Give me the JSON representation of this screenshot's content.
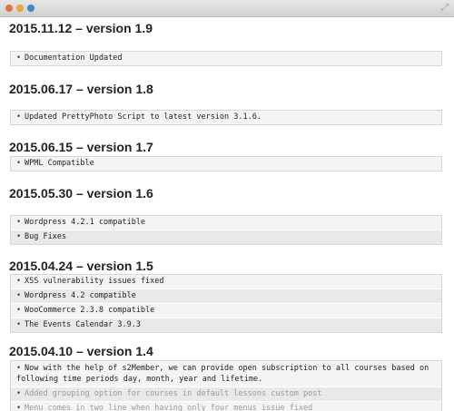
{
  "window": {
    "expand_glyph": "⤢"
  },
  "changelog": [
    {
      "title": "2015.11.12 – version 1.9",
      "items": [
        "Documentation Updated"
      ]
    },
    {
      "title": "2015.06.17 – version 1.8",
      "items": [
        "Updated PrettyPhoto Script to latest version 3.1.6."
      ]
    },
    {
      "title": "2015.06.15 – version 1.7",
      "items": [
        "WPML Compatible"
      ]
    },
    {
      "title": "2015.05.30 – version 1.6",
      "items": [
        "Wordpress 4.2.1 compatible",
        "Bug Fixes"
      ]
    },
    {
      "title": "2015.04.24 – version 1.5",
      "items": [
        "XSS vulnerability issues fixed",
        "Wordpress 4.2 compatible",
        "WooCommerce 2.3.8 compatible",
        "The Events Calendar 3.9.3"
      ]
    },
    {
      "title": "2015.04.10 – version 1.4",
      "items": [
        "Now with the help of s2Member, we can provide open subscription to all courses based on following time periods day, month, year and lifetime.",
        "Added grouping option for courses in default lessons custom post",
        "Menu comes in two line when having only four menus issue fixed"
      ]
    }
  ]
}
